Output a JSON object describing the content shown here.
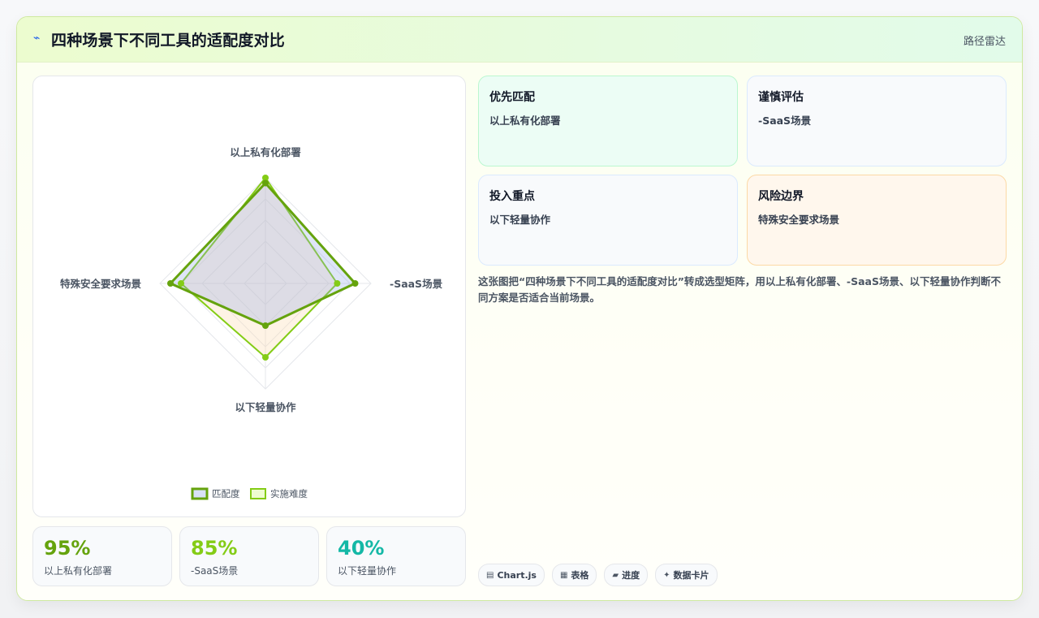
{
  "header": {
    "icon": "trend-icon",
    "title": "四种场景下不同工具的适配度对比",
    "tag": "路径雷达"
  },
  "chart_data": {
    "type": "radar",
    "axes": [
      "以上私有化部署",
      "-SaaS场景",
      "以下轻量协作",
      "特殊安全要求场景"
    ],
    "range": [
      0,
      100
    ],
    "grid": true,
    "legend_position": "bottom",
    "series": [
      {
        "name": "匹配度",
        "values": [
          95,
          85,
          40,
          90
        ],
        "color": "#65a30d"
      },
      {
        "name": "实施难度",
        "values": [
          100,
          68,
          70,
          80
        ],
        "color": "#84cc16"
      }
    ]
  },
  "stats": [
    {
      "value": "95%",
      "label": "以上私有化部署",
      "color": "#65a30d"
    },
    {
      "value": "85%",
      "label": "-SaaS场景",
      "color": "#84cc16"
    },
    {
      "value": "40%",
      "label": "以下轻量协作",
      "color": "#14b8a6"
    }
  ],
  "tiles": [
    {
      "title": "优先匹配",
      "text": "以上私有化部署",
      "bg": "#ecfdf5",
      "border": "#bbf7d0"
    },
    {
      "title": "谨慎评估",
      "text": "-SaaS场景",
      "bg": "#f8fafc",
      "border": "#dbeafe"
    },
    {
      "title": "投入重点",
      "text": "以下轻量协作",
      "bg": "#f8fafc",
      "border": "#dbeafe"
    },
    {
      "title": "风险边界",
      "text": "特殊安全要求场景",
      "bg": "#fff7ed",
      "border": "#fcd9a6"
    }
  ],
  "description": "这张图把“四种场景下不同工具的适配度对比”转成选型矩阵，用以上私有化部署、-SaaS场景、以下轻量协作判断不同方案是否适合当前场景。",
  "chips": [
    {
      "icon": "table-icon",
      "glyph": "▤",
      "label": "Chart.js"
    },
    {
      "icon": "grid-icon",
      "glyph": "▦",
      "label": "表格"
    },
    {
      "icon": "progress-icon",
      "glyph": "▰",
      "label": "进度"
    },
    {
      "icon": "sparkle-icon",
      "glyph": "✦",
      "label": "数据卡片"
    }
  ]
}
